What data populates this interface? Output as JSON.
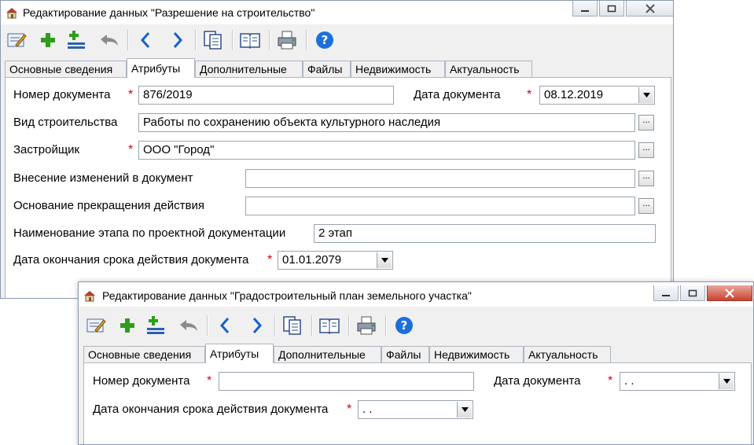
{
  "window1": {
    "title": "Редактирование данных \"Разрешение на строительство\"",
    "tabs": [
      "Основные сведения",
      "Атрибуты",
      "Дополнительные",
      "Файлы",
      "Недвижимость",
      "Актуальность"
    ],
    "active_tab": "Атрибуты",
    "fields": {
      "doc_number": {
        "label": "Номер документа",
        "value": "876/2019"
      },
      "doc_date": {
        "label": "Дата документа",
        "value": "08.12.2019"
      },
      "construction_type": {
        "label": "Вид строительства",
        "value": "Работы по сохранению объекта культурного наследия"
      },
      "developer": {
        "label": "Застройщик",
        "value": "ООО \"Город\""
      },
      "amendments": {
        "label": "Внесение изменений в документ",
        "value": ""
      },
      "termination_basis": {
        "label": "Основание прекращения действия",
        "value": ""
      },
      "stage_name": {
        "label": "Наименование этапа по проектной документации",
        "value": "2 этап"
      },
      "expiry_date": {
        "label": "Дата окончания срока действия документа",
        "value": "01.01.2079"
      }
    },
    "required_mark": "*",
    "ellipsis": "..."
  },
  "window2": {
    "title": "Редактирование данных \"Градостроительный план земельного участка\"",
    "tabs": [
      "Основные сведения",
      "Атрибуты",
      "Дополнительные",
      "Файлы",
      "Недвижимость",
      "Актуальность"
    ],
    "active_tab": "Атрибуты",
    "fields": {
      "doc_number": {
        "label": "Номер документа",
        "value": ""
      },
      "doc_date": {
        "label": "Дата документа",
        "value": " .  ."
      },
      "expiry_date": {
        "label": "Дата окончания срока действия документа",
        "value": " .  ."
      }
    },
    "required_mark": "*"
  },
  "toolbar_icons": [
    "edit-icon",
    "add-icon",
    "add-row-icon",
    "undo-icon",
    "previous-icon",
    "next-icon",
    "copy-icon",
    "book-icon",
    "print-icon",
    "help-icon"
  ],
  "colors": {
    "required": "#d0021b",
    "add": "#2e9e1a",
    "help": "#1e6fd9",
    "nav": "#1a5fc8"
  }
}
